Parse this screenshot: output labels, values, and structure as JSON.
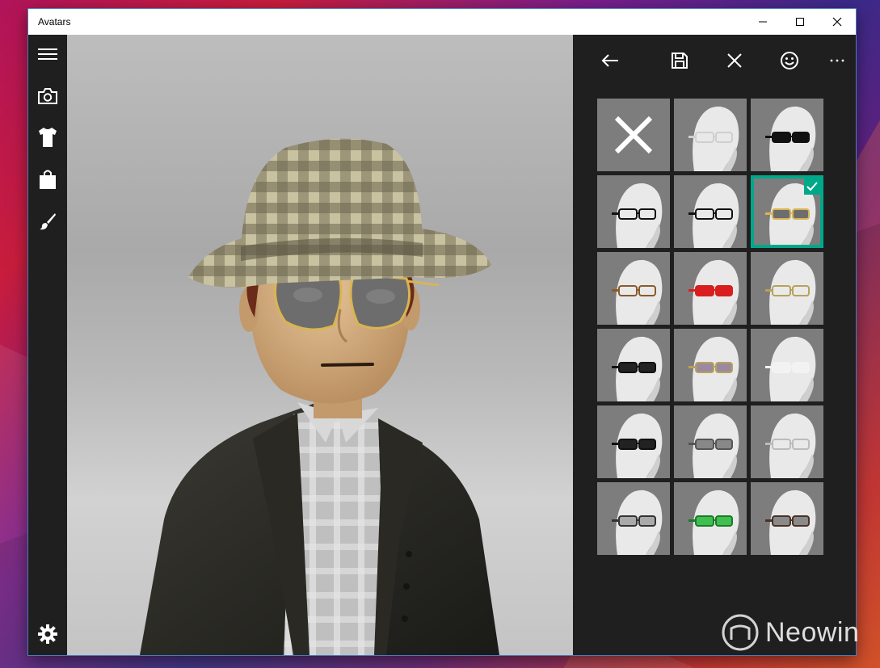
{
  "window": {
    "title": "Avatars"
  },
  "title_controls": {
    "minimize_icon": "minimize-icon",
    "maximize_icon": "maximize-icon",
    "close_icon": "close-icon"
  },
  "nav_rail": [
    {
      "name": "hamburger-menu-icon"
    },
    {
      "name": "camera-icon"
    },
    {
      "name": "shirt-icon"
    },
    {
      "name": "shopping-bag-icon"
    },
    {
      "name": "paintbrush-icon"
    },
    {
      "name": "settings-gear-icon"
    }
  ],
  "command_bar": [
    {
      "name": "back-arrow-icon"
    },
    {
      "name": "save-disk-icon"
    },
    {
      "name": "close-x-icon"
    },
    {
      "name": "smiley-face-icon"
    },
    {
      "name": "more-ellipsis-icon"
    }
  ],
  "glasses_grid": {
    "selected_index": 5,
    "items": [
      {
        "style": "none"
      },
      {
        "style": "thin-wire"
      },
      {
        "style": "dark-sunglasses"
      },
      {
        "style": "black-rectangle"
      },
      {
        "style": "round-black"
      },
      {
        "style": "gold-aviator"
      },
      {
        "style": "brown-wire"
      },
      {
        "style": "red-shutter"
      },
      {
        "style": "monocle"
      },
      {
        "style": "black-sunglasses"
      },
      {
        "style": "rose-tint"
      },
      {
        "style": "white-shutter"
      },
      {
        "style": "black-shutter"
      },
      {
        "style": "grey-tint"
      },
      {
        "style": "round-wire"
      },
      {
        "style": "half-rim"
      },
      {
        "style": "green-tint"
      },
      {
        "style": "brown-rectangle"
      }
    ]
  },
  "colors": {
    "accent": "#00a88a",
    "chrome": "#1f1f1f",
    "tile": "#7d7d7d"
  },
  "watermark": {
    "text": "Neowin"
  }
}
